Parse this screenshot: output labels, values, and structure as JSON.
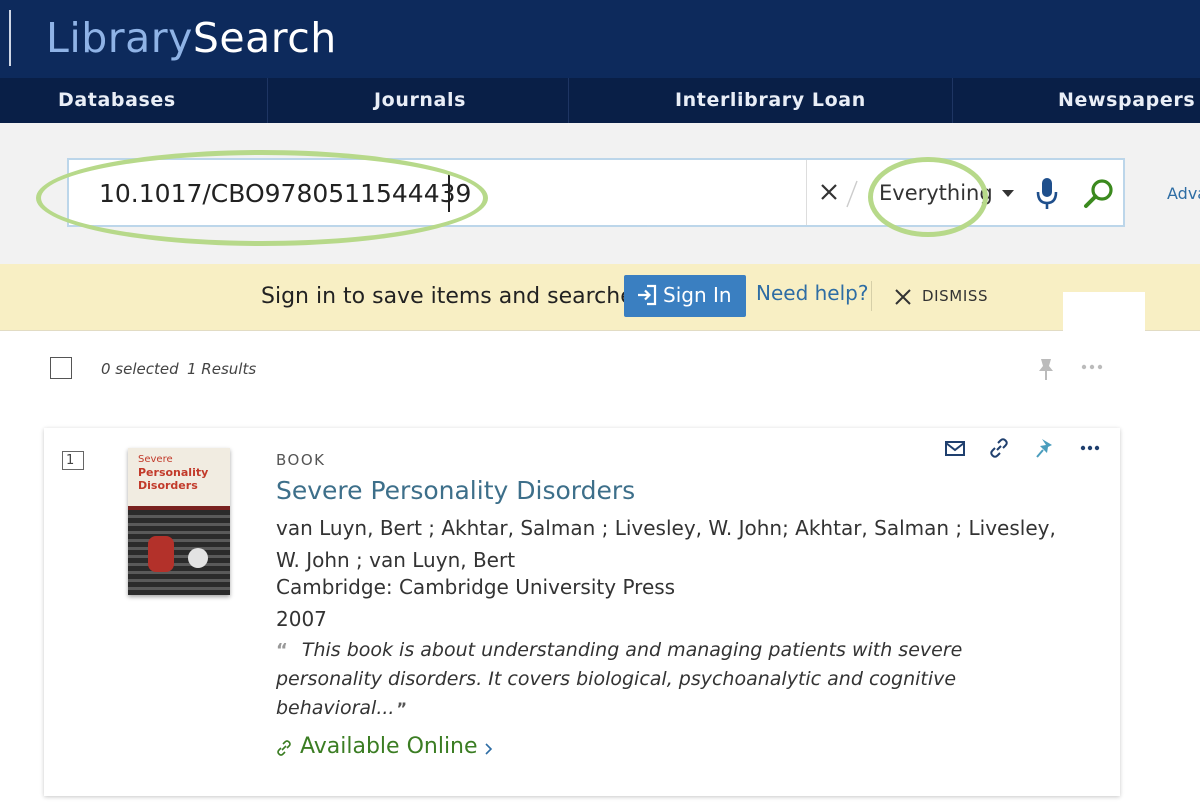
{
  "header": {
    "brand_part1": "Library",
    "brand_part2": "Search"
  },
  "nav": {
    "items": [
      {
        "label": "Databases"
      },
      {
        "label": "Journals"
      },
      {
        "label": "Interlibrary Loan"
      },
      {
        "label": "Newspapers"
      }
    ]
  },
  "search": {
    "query": "10.1017/CBO9780511544439",
    "scope": "Everything",
    "advanced_label": "Adva"
  },
  "signin_bar": {
    "message": "Sign in to save items and searches",
    "signin_label": "Sign In",
    "help_label": "Need help?",
    "dismiss_label": "DISMISS"
  },
  "results_bar": {
    "selected": "0 selected",
    "count": "1 Results"
  },
  "results": [
    {
      "index": "1",
      "type": "BOOK",
      "title": "Severe Personality Disorders",
      "authors": "van Luyn, Bert ; Akhtar, Salman ; Livesley, W. John; Akhtar, Salman ; Livesley, W. John ; van Luyn, Bert",
      "publisher": "Cambridge: Cambridge University Press",
      "year": "2007",
      "abstract": "This book is about understanding and managing patients with severe personality disorders. It covers biological, psychoanalytic and cognitive behavioral...",
      "availability": "Available Online",
      "cover": {
        "line1": "Severe",
        "line2": "Personality",
        "line3": "Disorders"
      }
    }
  ],
  "colors": {
    "header_bg": "#0d2a5c",
    "nav_bg": "#091f47",
    "brand_light": "#8fb3e6",
    "signin_banner": "#f8efc4",
    "signin_button": "#3a7fc1",
    "link_blue": "#2e6da4",
    "title_blue": "#3d6f8a",
    "available_green": "#3b7d23",
    "highlight_ring": "#b7d98a"
  },
  "icons": {
    "clear": "close-icon",
    "mic": "microphone-icon",
    "search": "search-icon",
    "signin": "sign-in-icon",
    "dismiss": "close-icon",
    "pin": "pin-icon",
    "more": "more-icon",
    "email": "email-icon",
    "link": "link-icon",
    "available": "link-icon",
    "chevron": "chevron-right-icon"
  }
}
